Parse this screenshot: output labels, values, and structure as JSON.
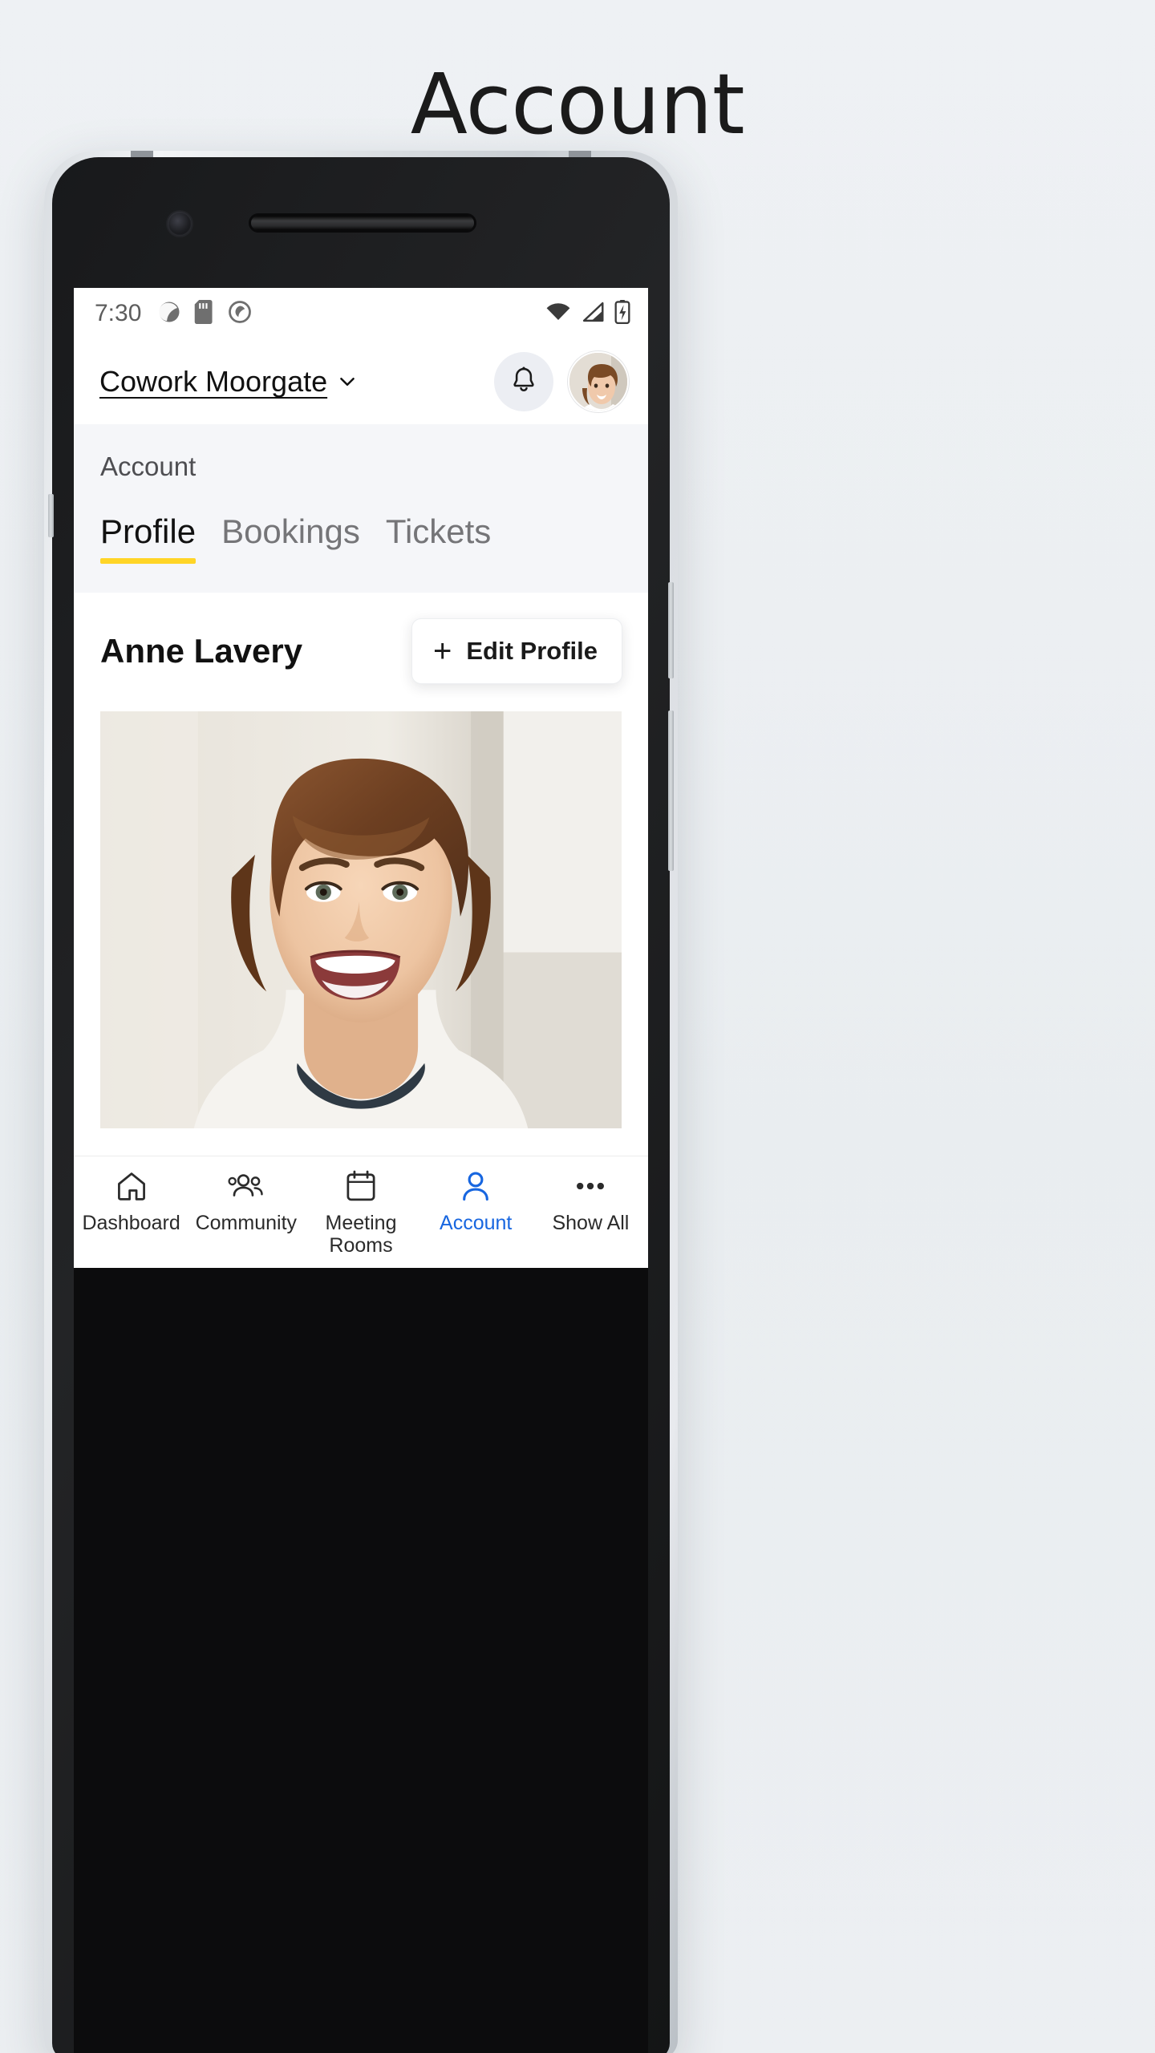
{
  "page": {
    "title": "Account"
  },
  "status_bar": {
    "time": "7:30",
    "left_icons": [
      "sync-icon",
      "sd-card-icon",
      "do-not-disturb-icon"
    ],
    "right_icons": [
      "wifi-icon",
      "cellular-signal-icon",
      "battery-icon"
    ]
  },
  "app_bar": {
    "venue_name": "Cowork Moorgate",
    "venue_chevron": "chevron-down-icon",
    "notifications_icon": "bell-icon",
    "avatar": "user-avatar"
  },
  "section": {
    "label": "Account",
    "tabs": [
      {
        "label": "Profile",
        "active": true
      },
      {
        "label": "Bookings",
        "active": false
      },
      {
        "label": "Tickets",
        "active": false
      }
    ]
  },
  "profile": {
    "name": "Anne Lavery",
    "edit_button": {
      "plus": "+",
      "label": "Edit Profile"
    },
    "photo_alt": "profile-photo"
  },
  "bottom_nav": [
    {
      "label": "Dashboard",
      "icon": "home-icon",
      "active": false
    },
    {
      "label": "Community",
      "icon": "people-icon",
      "active": false
    },
    {
      "label": "Meeting Rooms",
      "icon": "calendar-icon",
      "active": false
    },
    {
      "label": "Account",
      "icon": "person-icon",
      "active": true
    },
    {
      "label": "Show All",
      "icon": "more-horizontal-icon",
      "active": false
    }
  ],
  "colors": {
    "accent_yellow": "#ffd527",
    "active_blue": "#1766e0",
    "page_background": "#eceff2",
    "section_background": "#f5f6f9"
  }
}
